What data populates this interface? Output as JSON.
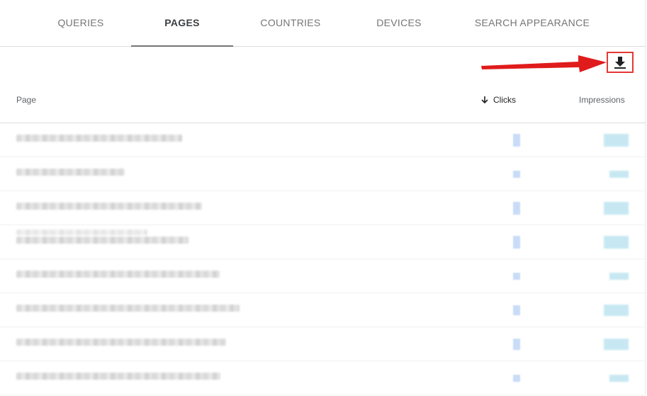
{
  "tabs": [
    {
      "label": "QUERIES",
      "active": false
    },
    {
      "label": "PAGES",
      "active": true
    },
    {
      "label": "COUNTRIES",
      "active": false
    },
    {
      "label": "DEVICES",
      "active": false
    },
    {
      "label": "SEARCH APPEARANCE",
      "active": false
    }
  ],
  "table": {
    "columns": {
      "page": "Page",
      "clicks": "Clicks",
      "impressions": "Impressions"
    },
    "sort": {
      "column": "clicks",
      "direction": "descending",
      "icon": "arrow-down-icon"
    },
    "row_count": 8
  },
  "toolbar": {
    "download_icon": "download-icon"
  },
  "annotation": {
    "arrow_color": "#e53935",
    "highlight_color": "#e53935"
  },
  "colors": {
    "active_tab": "#3c4043",
    "inactive_tab": "#757575",
    "clicks_bar": "#c9dcf7",
    "impressions_bar": "#c7e8f2"
  }
}
